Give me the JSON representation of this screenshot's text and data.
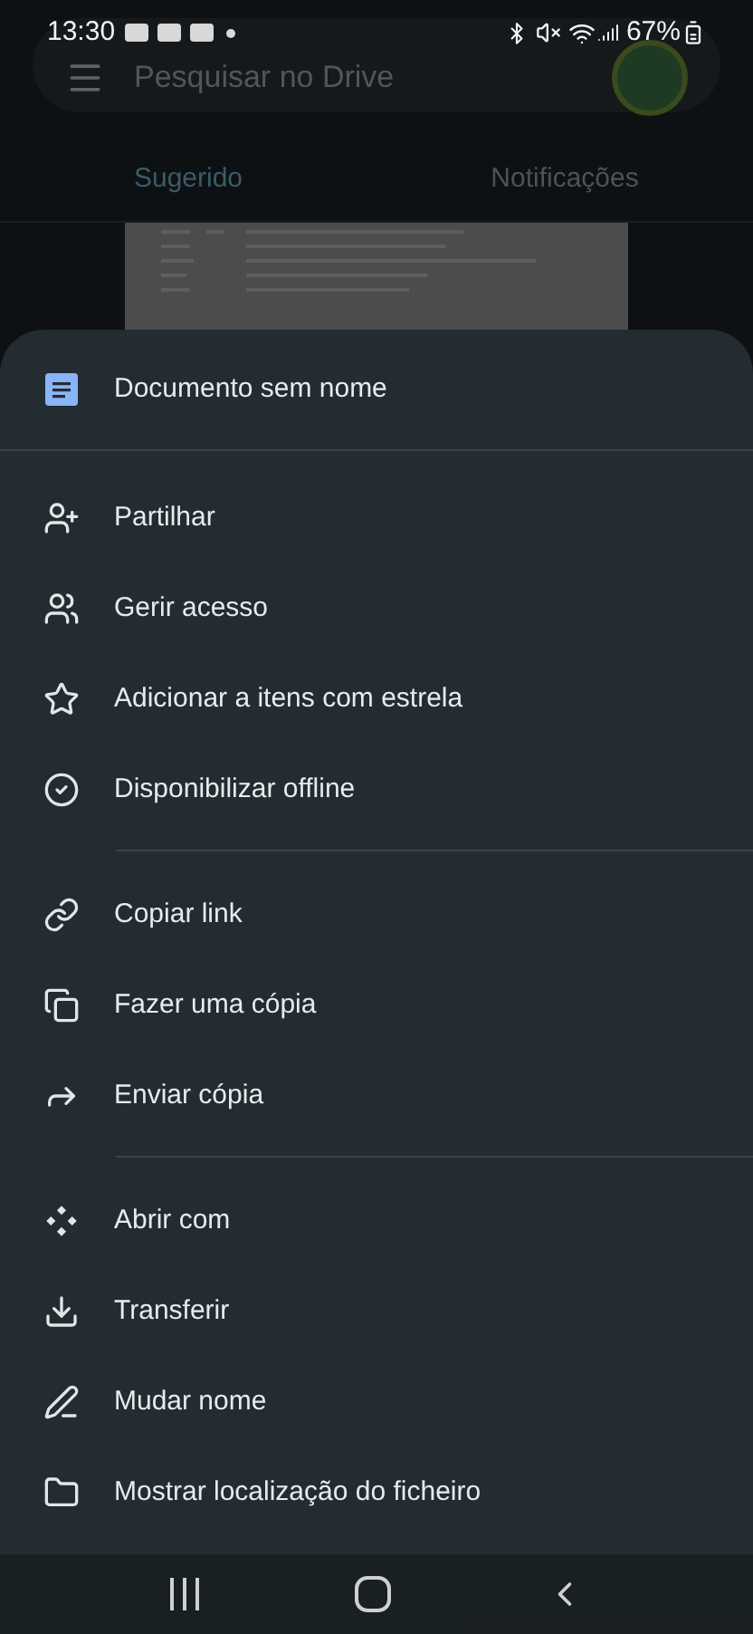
{
  "status_bar": {
    "time": "13:30",
    "battery": "67%"
  },
  "search": {
    "placeholder": "Pesquisar no Drive"
  },
  "tabs": [
    {
      "label": "Sugerido",
      "selected": true
    },
    {
      "label": "Notificações",
      "selected": false
    }
  ],
  "sheet": {
    "title": "Documento sem nome",
    "sections": [
      [
        "Partilhar",
        "Gerir acesso",
        "Adicionar a itens com estrela",
        "Disponibilizar offline"
      ],
      [
        "Copiar link",
        "Fazer uma cópia",
        "Enviar cópia"
      ],
      [
        "Abrir com",
        "Transferir",
        "Mudar nome",
        "Mostrar localização do ficheiro"
      ]
    ]
  }
}
